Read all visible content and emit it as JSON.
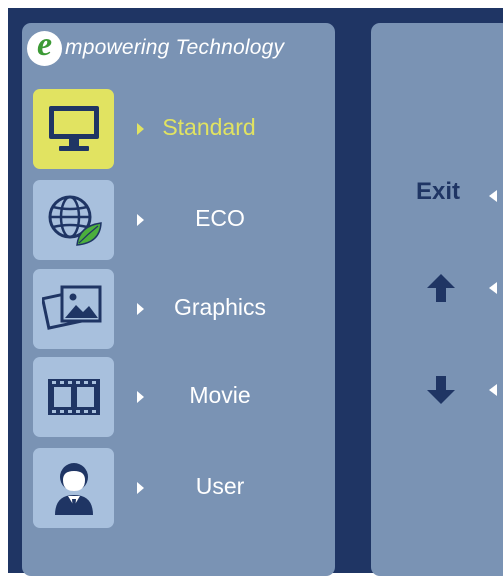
{
  "brand": {
    "logo_letter": "e",
    "tagline": "mpowering Technology"
  },
  "modes": [
    {
      "label": "Standard",
      "icon": "monitor-icon",
      "selected": true
    },
    {
      "label": "ECO",
      "icon": "globe-leaf-icon",
      "selected": false
    },
    {
      "label": "Graphics",
      "icon": "pictures-icon",
      "selected": false
    },
    {
      "label": "Movie",
      "icon": "film-strip-icon",
      "selected": false
    },
    {
      "label": "User",
      "icon": "user-icon",
      "selected": false
    }
  ],
  "keys": {
    "exit_label": "Exit",
    "up_icon": "arrow-up-icon",
    "down_icon": "arrow-down-icon"
  },
  "colors": {
    "background": "#1f3564",
    "panel": "#7a93b4",
    "icon_tile": "#a8c0dd",
    "selected": "#e1e361",
    "leaf": "#4caf3d"
  }
}
